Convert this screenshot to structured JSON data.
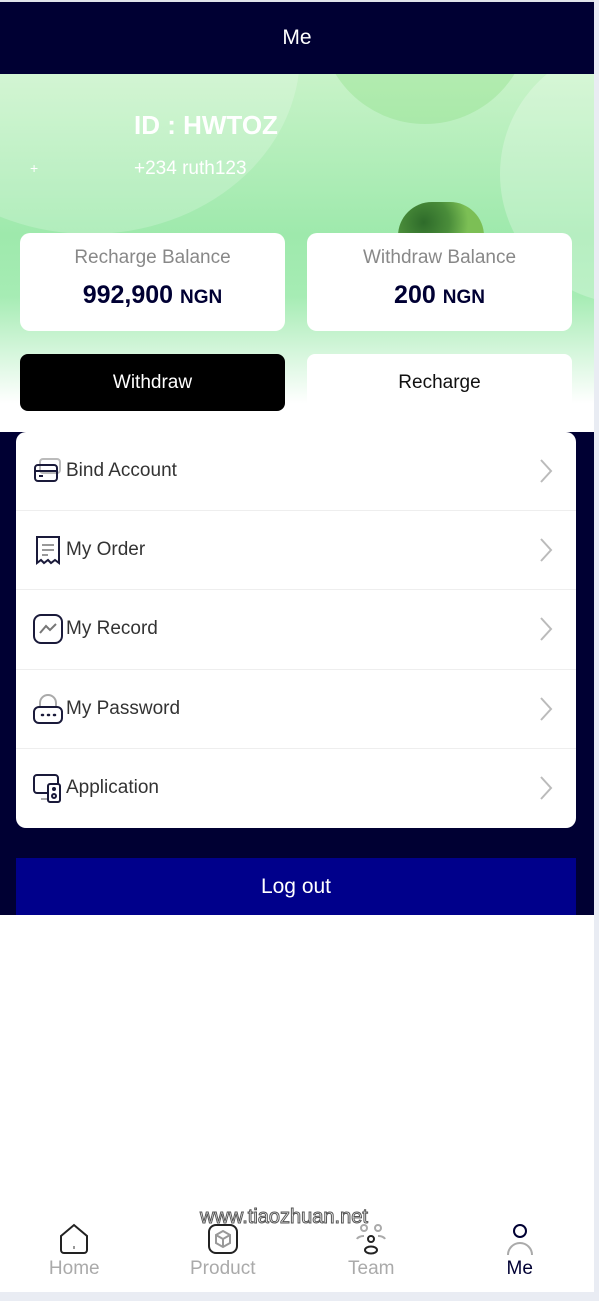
{
  "header": {
    "title": "Me"
  },
  "profile": {
    "id_label": "ID : HWTOZ",
    "phone": "+234 ruth123"
  },
  "balances": [
    {
      "label": "Recharge Balance",
      "value": "992,900",
      "currency": "NGN"
    },
    {
      "label": "Withdraw Balance",
      "value": "200",
      "currency": "NGN"
    }
  ],
  "actions": {
    "withdraw": "Withdraw",
    "recharge": "Recharge"
  },
  "menu": [
    {
      "label": "Bind Account",
      "icon": "card-icon"
    },
    {
      "label": "My Order",
      "icon": "receipt-icon"
    },
    {
      "label": "My Record",
      "icon": "chart-icon"
    },
    {
      "label": "My Password",
      "icon": "lock-icon"
    },
    {
      "label": "Application",
      "icon": "device-icon"
    }
  ],
  "logout": "Log out",
  "nav": [
    {
      "label": "Home",
      "icon": "home-icon"
    },
    {
      "label": "Product",
      "icon": "box-icon"
    },
    {
      "label": "Team",
      "icon": "team-icon"
    },
    {
      "label": "Me",
      "icon": "user-icon",
      "active": true
    }
  ],
  "watermark": "www.tiaozhuan.net",
  "colors": {
    "header": "#000033",
    "logout": "#00008b",
    "withdraw_button": "#000000"
  }
}
